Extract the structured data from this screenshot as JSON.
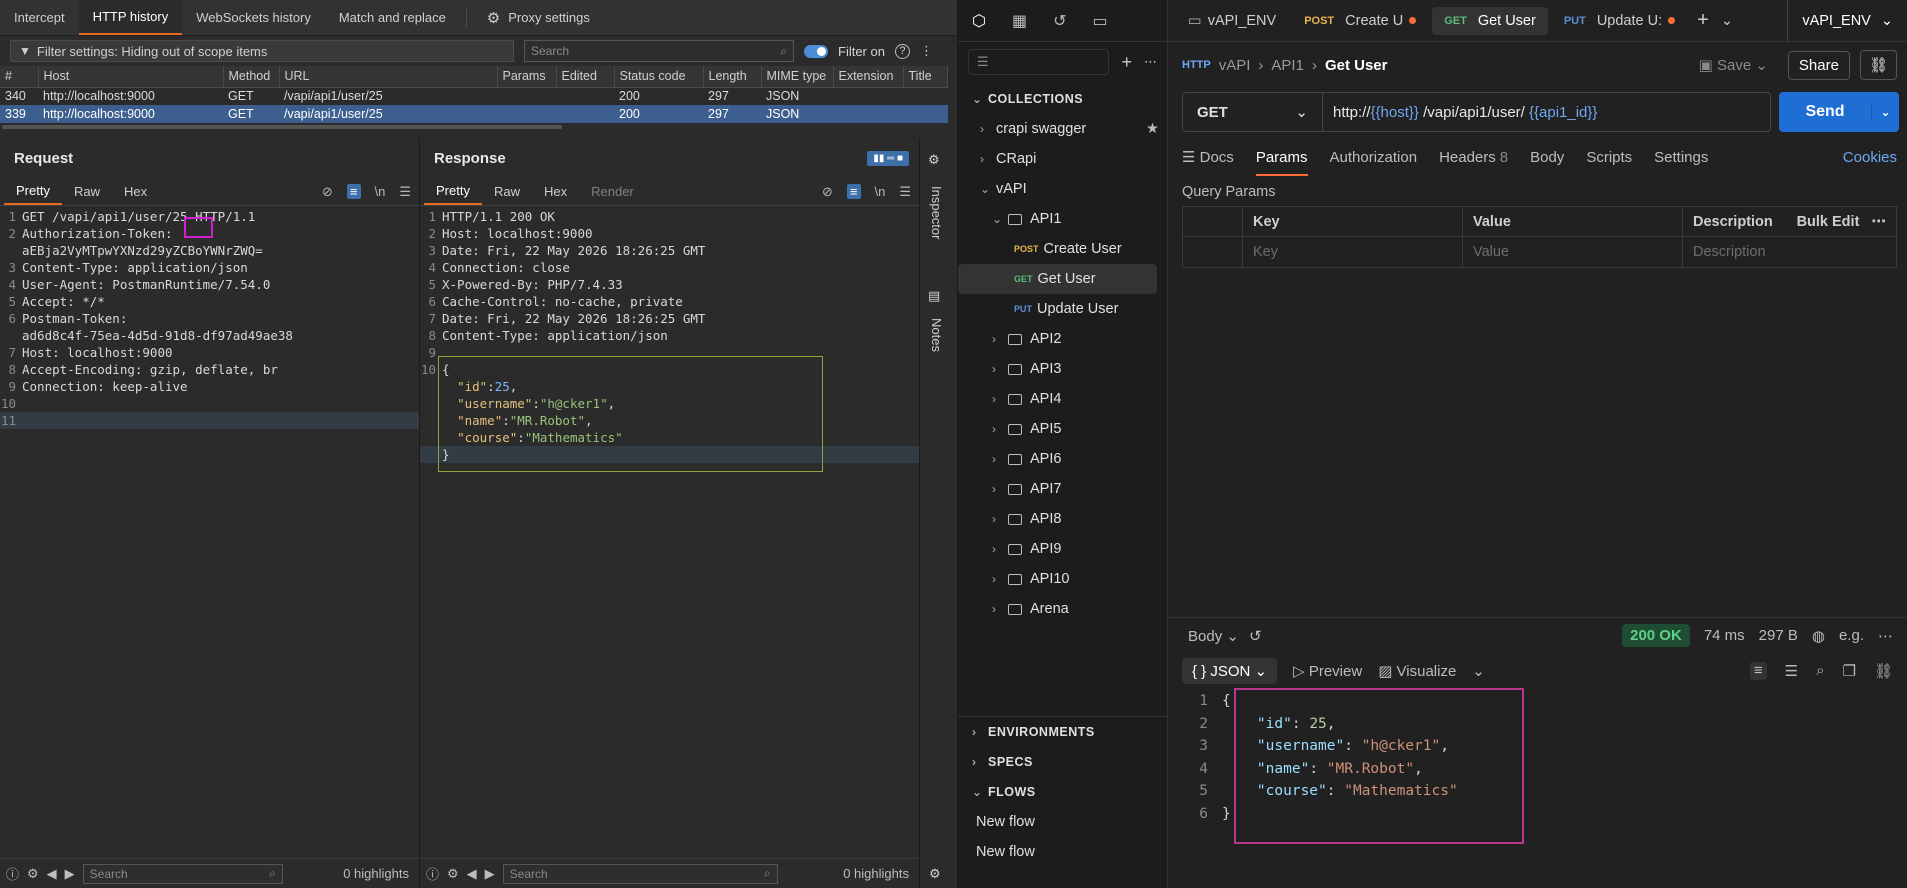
{
  "burp": {
    "tabs": [
      {
        "label": "Intercept"
      },
      {
        "label": "HTTP history"
      },
      {
        "label": "WebSockets history"
      },
      {
        "label": "Match and replace"
      },
      {
        "label": "Proxy settings"
      }
    ],
    "filter_text": "Filter settings: Hiding out of scope items",
    "search_placeholder": "Search",
    "filter_on_label": "Filter on",
    "columns": [
      "#",
      "Host",
      "Method",
      "URL",
      "Params",
      "Edited",
      "Status code",
      "Length",
      "MIME type",
      "Extension",
      "Title"
    ],
    "rows": [
      {
        "num": "340",
        "host": "http://localhost:9000",
        "method": "GET",
        "url": "/vapi/api1/user/25",
        "params": "",
        "edited": "",
        "status": "200",
        "length": "297",
        "mime": "JSON",
        "ext": "",
        "title": ""
      },
      {
        "num": "339",
        "host": "http://localhost:9000",
        "method": "GET",
        "url": "/vapi/api1/user/25",
        "params": "",
        "edited": "",
        "status": "200",
        "length": "297",
        "mime": "JSON",
        "ext": "",
        "title": ""
      }
    ],
    "request": {
      "title": "Request",
      "tabs": [
        "Pretty",
        "Raw",
        "Hex"
      ],
      "line1_prefix": "GET /vapi/api1/user/",
      "line1_id": "25",
      "line1_suffix": " HTTP/1.1",
      "lines": [
        {
          "n": "2",
          "text": "Authorization-Token:"
        },
        {
          "n": "",
          "text": "aEBja2VyMTpwYXNzd29yZCBoYWNrZWQ="
        },
        {
          "n": "3",
          "text": "Content-Type: application/json"
        },
        {
          "n": "4",
          "text": "User-Agent: PostmanRuntime/7.54.0"
        },
        {
          "n": "5",
          "text": "Accept: */*"
        },
        {
          "n": "6",
          "text": "Postman-Token:"
        },
        {
          "n": "",
          "text": "ad6d8c4f-75ea-4d5d-91d8-df97ad49ae38"
        },
        {
          "n": "7",
          "text": "Host: localhost:9000"
        },
        {
          "n": "8",
          "text": "Accept-Encoding: gzip, deflate, br"
        },
        {
          "n": "9",
          "text": "Connection: keep-alive"
        },
        {
          "n": "10",
          "text": ""
        },
        {
          "n": "11",
          "text": ""
        }
      ],
      "highlights": "0 highlights",
      "search_placeholder": "Search"
    },
    "response": {
      "title": "Response",
      "tabs": [
        "Pretty",
        "Raw",
        "Hex",
        "Render"
      ],
      "lines": [
        {
          "n": "1",
          "text": "HTTP/1.1 200 OK"
        },
        {
          "n": "2",
          "text": "Host: localhost:9000"
        },
        {
          "n": "3",
          "text": "Date: Fri, 22 May 2026 18:26:25 GMT"
        },
        {
          "n": "4",
          "text": "Connection: close"
        },
        {
          "n": "5",
          "text": "X-Powered-By: PHP/7.4.33"
        },
        {
          "n": "6",
          "text": "Cache-Control: no-cache, private"
        },
        {
          "n": "7",
          "text": "Date: Fri, 22 May 2026 18:26:25 GMT"
        },
        {
          "n": "8",
          "text": "Content-Type: application/json"
        },
        {
          "n": "9",
          "text": ""
        }
      ],
      "json_open": "{",
      "json_close": "}",
      "json": [
        {
          "k": "\"id\"",
          "v": "25",
          "type": "num"
        },
        {
          "k": "\"username\"",
          "v": "\"h@cker1\"",
          "type": "str"
        },
        {
          "k": "\"name\"",
          "v": "\"MR.Robot\"",
          "type": "str"
        },
        {
          "k": "\"course\"",
          "v": "\"Mathematics\"",
          "type": "str"
        }
      ],
      "highlights": "0 highlights",
      "search_placeholder": "Search"
    },
    "side_labels": [
      "Inspector",
      "Notes"
    ]
  },
  "postman": {
    "tabs": [
      {
        "method": "",
        "label": "vAPI_ENV",
        "dot": false
      },
      {
        "method": "POST",
        "label": "Create U",
        "dot": true
      },
      {
        "method": "GET",
        "label": "Get User",
        "dot": false
      },
      {
        "method": "PUT",
        "label": "Update U:",
        "dot": true
      }
    ],
    "env": "vAPI_ENV",
    "sidebar": {
      "collections_header": "COLLECTIONS",
      "collections": [
        {
          "label": "crapi swagger"
        },
        {
          "label": "CRapi"
        },
        {
          "label": "vAPI"
        }
      ],
      "api1": "API1",
      "requests": [
        {
          "method": "POST",
          "label": "Create User"
        },
        {
          "method": "GET",
          "label": "Get User"
        },
        {
          "method": "PUT",
          "label": "Update User"
        }
      ],
      "folders": [
        "API2",
        "API3",
        "API4",
        "API5",
        "API6",
        "API7",
        "API8",
        "API9",
        "API10",
        "Arena"
      ],
      "environments": "ENVIRONMENTS",
      "specs": "SPECS",
      "flows": "FLOWS",
      "flow_items": [
        "New flow",
        "New flow"
      ]
    },
    "breadcrumb": {
      "c1": "vAPI",
      "c2": "API1",
      "current": "Get User"
    },
    "save_label": "Save",
    "share_label": "Share",
    "method": "GET",
    "url": {
      "p1": "http://",
      "v1": "{{host}}",
      "p2": " /vapi/api1/user/ ",
      "v2": "{{api1_id}}"
    },
    "send_label": "Send",
    "req_tabs": [
      "Docs",
      "Params",
      "Authorization",
      "Headers",
      "Body",
      "Scripts",
      "Settings"
    ],
    "headers_count": "8",
    "cookies_label": "Cookies",
    "query_params_label": "Query Params",
    "qp_headers": [
      "Key",
      "Value",
      "Description",
      "Bulk Edit"
    ],
    "qp_placeholders": [
      "Key",
      "Value",
      "Description"
    ],
    "response": {
      "body_label": "Body",
      "status": "200 OK",
      "time": "74 ms",
      "size": "297 B",
      "format": "JSON",
      "preview": "Preview",
      "visualize": "Visualize",
      "lines": [
        {
          "n": "1",
          "open": "{"
        },
        {
          "n": "2",
          "k": "\"id\"",
          "v": "25",
          "type": "num",
          "comma": ","
        },
        {
          "n": "3",
          "k": "\"username\"",
          "v": "\"h@cker1\"",
          "type": "str",
          "comma": ","
        },
        {
          "n": "4",
          "k": "\"name\"",
          "v": "\"MR.Robot\"",
          "type": "str",
          "comma": ","
        },
        {
          "n": "5",
          "k": "\"course\"",
          "v": "\"Mathematics\"",
          "type": "str",
          "comma": ""
        },
        {
          "n": "6",
          "open": "}"
        }
      ]
    }
  }
}
